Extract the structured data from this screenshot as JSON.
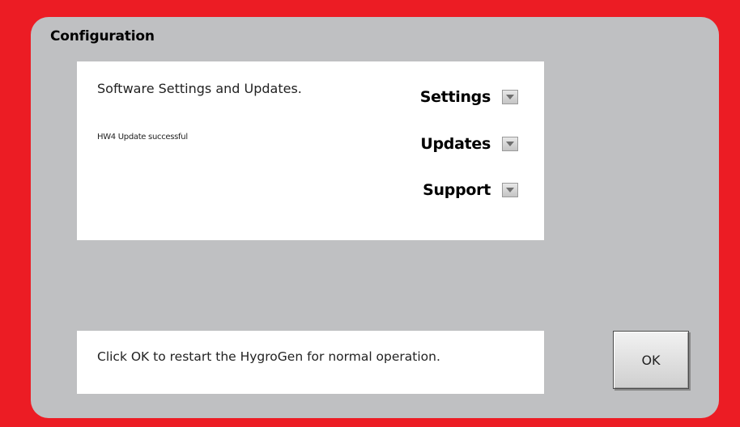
{
  "dialog": {
    "title": "Configuration"
  },
  "content": {
    "heading": "Software Settings and Updates.",
    "status": "HW4 Update successful",
    "menu": [
      {
        "label": "Settings",
        "icon": "dropdown-arrow-icon"
      },
      {
        "label": "Updates",
        "icon": "dropdown-arrow-icon"
      },
      {
        "label": "Support",
        "icon": "dropdown-arrow-icon"
      }
    ]
  },
  "footer": {
    "message": "Click OK to restart the HygroGen for normal operation.",
    "ok_label": "OK"
  },
  "colors": {
    "background": "#ec1c24",
    "panel": "#bfc0c2",
    "box": "#ffffff"
  }
}
